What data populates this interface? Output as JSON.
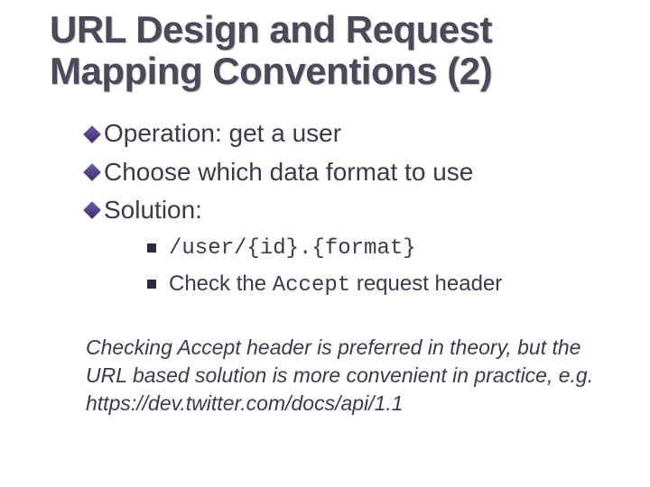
{
  "title": "URL Design and Request Mapping Conventions (2)",
  "bullets": [
    "Operation: get a user",
    "Choose which data format to use",
    "Solution:"
  ],
  "sub": {
    "code_line": "/user/{id}.{format}",
    "check_prefix": "Check the ",
    "check_code": "Accept",
    "check_suffix": " request header"
  },
  "note": "Checking Accept header is preferred in theory, but the URL based solution is more convenient in practice, e.g. https://dev.twitter.com/docs/api/1.1"
}
